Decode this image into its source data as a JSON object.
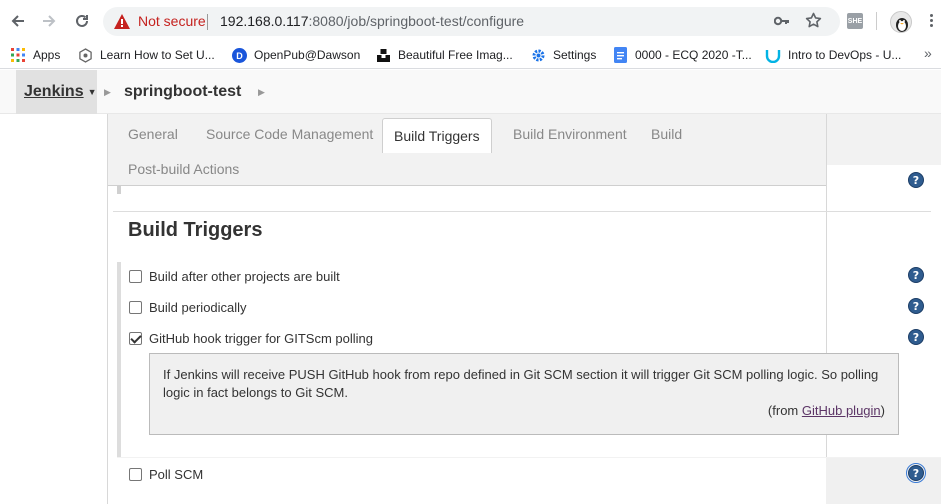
{
  "browser": {
    "security_label": "Not secure",
    "url_host": "192.168.0.117",
    "url_rest": ":8080/job/springboot-test/configure",
    "extension_label": "SHE"
  },
  "bookmarks": {
    "items": [
      {
        "label": "Apps"
      },
      {
        "label": "Learn How to Set U..."
      },
      {
        "label": "OpenPub@Dawson"
      },
      {
        "label": "Beautiful Free Imag..."
      },
      {
        "label": "Settings"
      },
      {
        "label": "0000 - ECQ 2020 -T..."
      },
      {
        "label": "Intro to DevOps - U..."
      }
    ],
    "more": "»"
  },
  "breadcrumb": {
    "root": "Jenkins",
    "job": "springboot-test"
  },
  "tabs": [
    {
      "label": "General"
    },
    {
      "label": "Source Code Management"
    },
    {
      "label": "Build Triggers",
      "active": true
    },
    {
      "label": "Build Environment"
    },
    {
      "label": "Build"
    },
    {
      "label": "Post-build Actions"
    }
  ],
  "section": {
    "title": "Build Triggers"
  },
  "triggers": [
    {
      "label": "Build after other projects are built",
      "checked": false
    },
    {
      "label": "Build periodically",
      "checked": false
    },
    {
      "label": "GitHub hook trigger for GITScm polling",
      "checked": true
    },
    {
      "label": "Poll SCM",
      "checked": false
    }
  ],
  "help": {
    "text": "If Jenkins will receive PUSH GitHub hook from repo defined in Git SCM section it will trigger Git SCM polling logic. So polling logic in fact belongs to Git SCM.",
    "from_prefix": "(from ",
    "from_link": "GitHub plugin",
    "from_suffix": ")",
    "icon_glyph": "?"
  },
  "colors": {
    "help_icon": "#2f5c8f",
    "not_secure": "#c5221f",
    "link": "#5c3566"
  }
}
